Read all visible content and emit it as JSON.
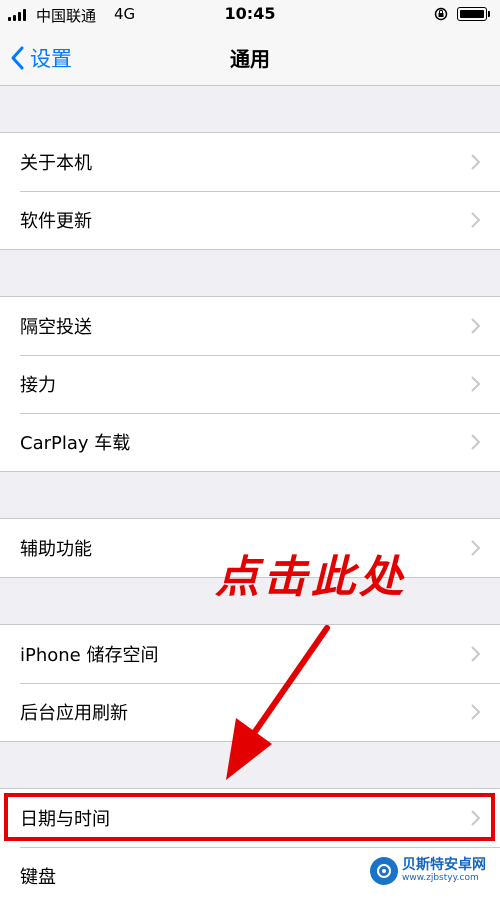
{
  "status_bar": {
    "carrier": "中国联通",
    "network": "4G",
    "time": "10:45"
  },
  "nav": {
    "back_label": "设置",
    "title": "通用"
  },
  "sections": [
    {
      "items": [
        {
          "label": "关于本机"
        },
        {
          "label": "软件更新"
        }
      ]
    },
    {
      "items": [
        {
          "label": "隔空投送"
        },
        {
          "label": "接力"
        },
        {
          "label": "CarPlay 车载"
        }
      ]
    },
    {
      "items": [
        {
          "label": "辅助功能"
        }
      ]
    },
    {
      "items": [
        {
          "label": "iPhone 储存空间"
        },
        {
          "label": "后台应用刷新"
        }
      ]
    },
    {
      "items": [
        {
          "label": "日期与时间"
        },
        {
          "label": "键盘"
        }
      ]
    }
  ],
  "annotation": {
    "callout_text": "点击此处",
    "color": "#e30000"
  },
  "watermark": {
    "name": "贝斯特安卓网",
    "url": "www.zjbstyy.com"
  },
  "colors": {
    "accent": "#007aff",
    "background": "#efeff4",
    "separator": "#c8c7cc"
  }
}
